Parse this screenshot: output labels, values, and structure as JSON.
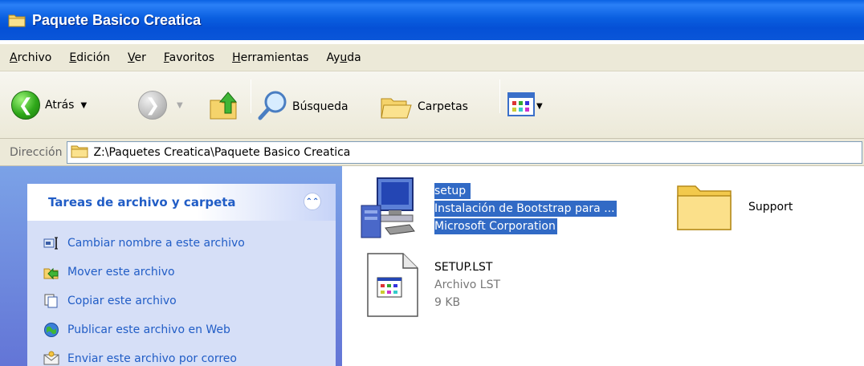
{
  "window": {
    "title": "Paquete Basico Creatica"
  },
  "menu": [
    {
      "label": "Archivo",
      "key": "A",
      "rest": "rchivo"
    },
    {
      "label": "Edición",
      "key": "E",
      "rest": "dición"
    },
    {
      "label": "Ver",
      "key": "V",
      "rest": "er"
    },
    {
      "label": "Favoritos",
      "key": "F",
      "rest": "avoritos"
    },
    {
      "label": "Herramientas",
      "key": "H",
      "rest": "erramientas"
    },
    {
      "label": "Ayuda",
      "key": "u",
      "pre": "Ay",
      "rest": "da"
    }
  ],
  "toolbar": {
    "back_label": "Atrás",
    "search_label": "Búsqueda",
    "folders_label": "Carpetas"
  },
  "address": {
    "label": "Dirección",
    "path": "Z:\\Paquetes Creatica\\Paquete Basico Creatica"
  },
  "tasks": {
    "title": "Tareas de archivo y carpeta",
    "items": [
      {
        "label": "Cambiar nombre a este archivo",
        "icon": "rename-icon"
      },
      {
        "label": "Mover este archivo",
        "icon": "move-icon"
      },
      {
        "label": "Copiar este archivo",
        "icon": "copy-icon"
      },
      {
        "label": "Publicar este archivo en Web",
        "icon": "publish-web-icon"
      },
      {
        "label": "Enviar este archivo por correo",
        "icon": "email-icon"
      }
    ]
  },
  "files": [
    {
      "name": "setup",
      "line2": "Instalación de Bootstrap para ...",
      "line3": "Microsoft Corporation",
      "selected": true
    },
    {
      "name": "Support",
      "type": "folder"
    },
    {
      "name": "SETUP.LST",
      "line2": "Archivo LST",
      "line3": "9 KB"
    }
  ],
  "colors": {
    "titlebar": "#0a5fe0",
    "selection": "#316ac5",
    "task_link": "#215dc6"
  }
}
